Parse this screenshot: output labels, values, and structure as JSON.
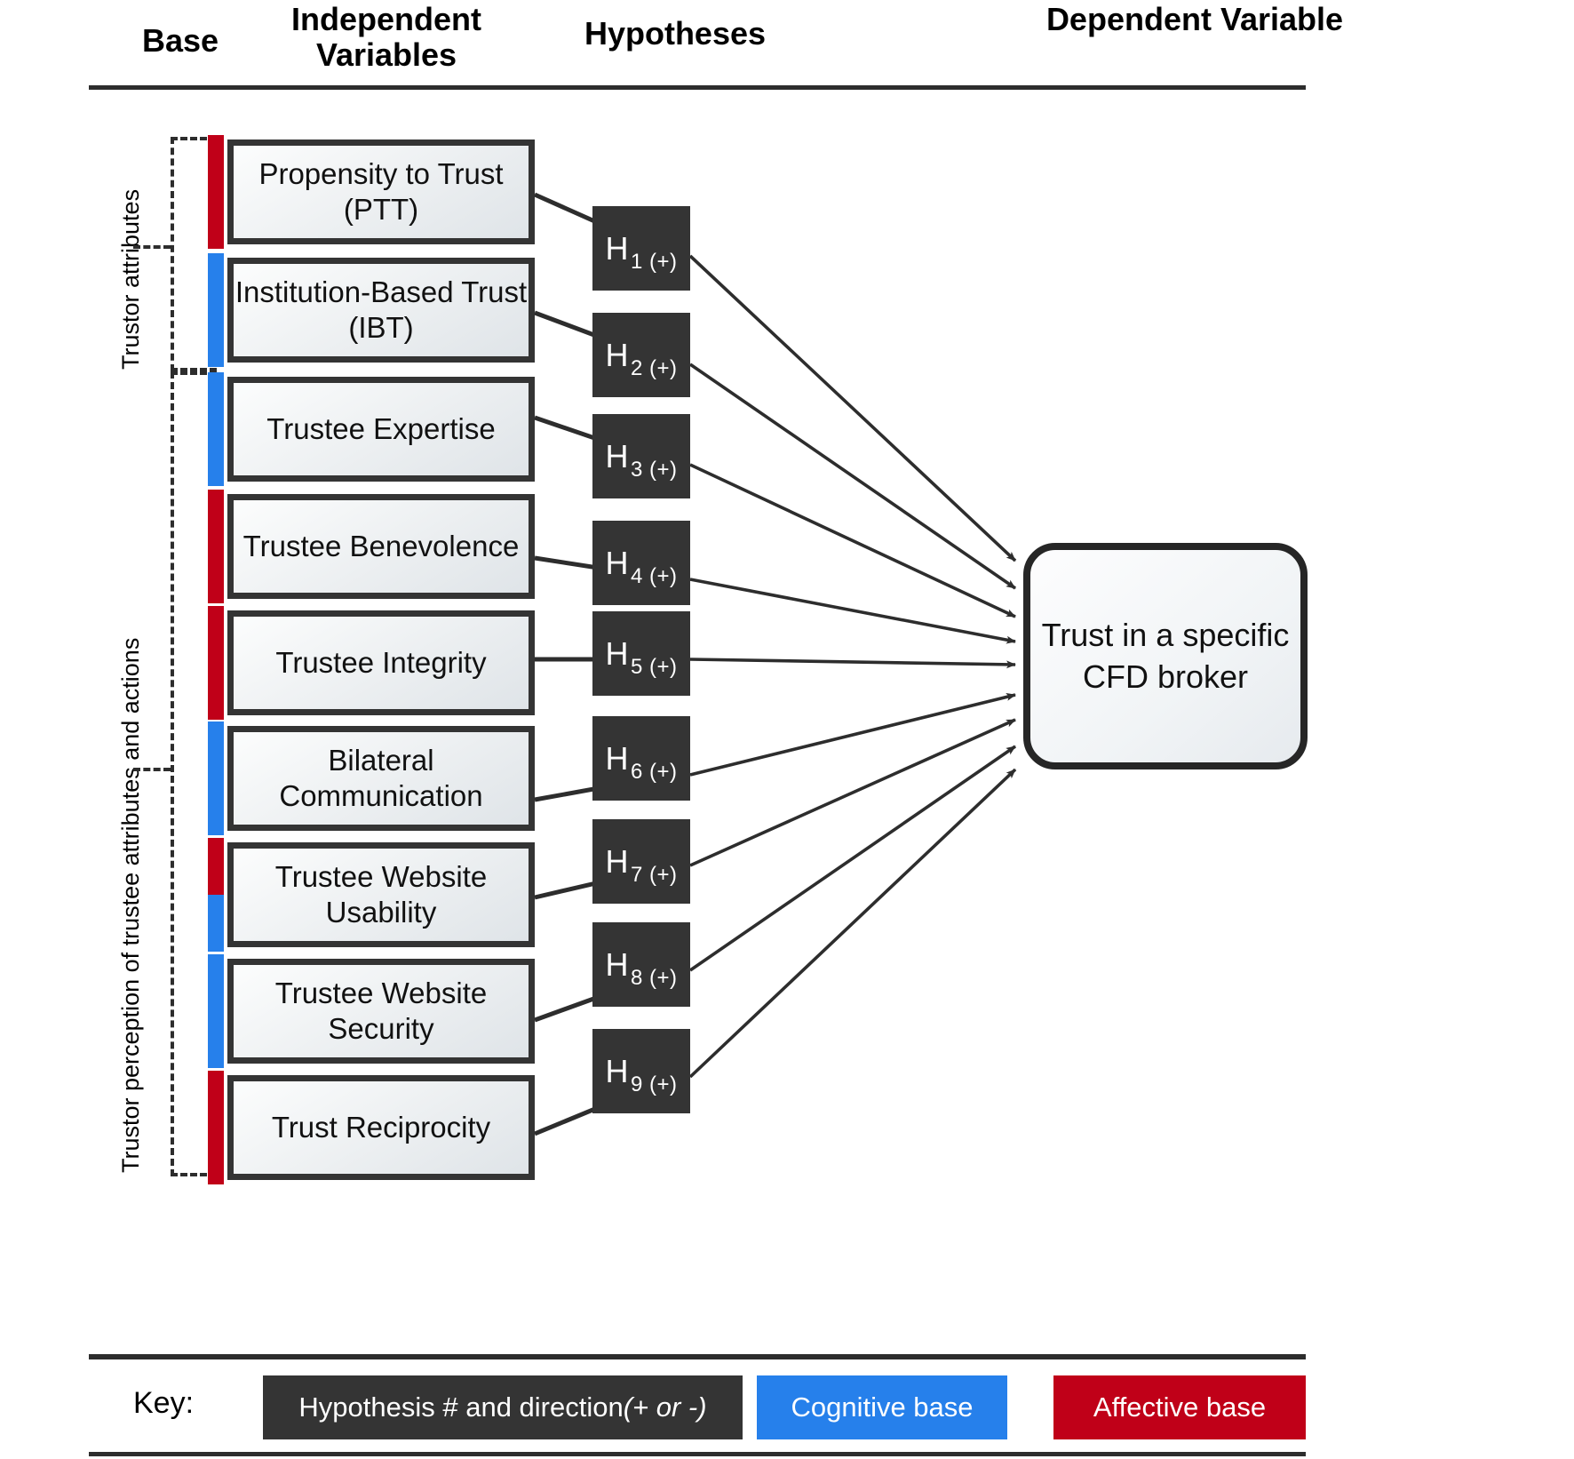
{
  "headers": {
    "base": "Base",
    "independent_variables": "Independent Variables",
    "hypotheses": "Hypotheses",
    "dependent_variable": "Dependent Variable"
  },
  "groups": [
    {
      "id": "trustor-attributes",
      "label": "Trustor attributes"
    },
    {
      "id": "trustor-perception",
      "label": "Trustor perception of trustee attributes and actions"
    }
  ],
  "colors": {
    "cognitive_base": "#2680EB",
    "affective_base": "#C00018",
    "hypothesis_box": "#343434",
    "outline": "#343434"
  },
  "independent_variables": [
    {
      "label": "Propensity to Trust (PTT)",
      "bases": [
        "affective"
      ],
      "hypothesis": "H1"
    },
    {
      "label": "Institution-Based Trust (IBT)",
      "bases": [
        "cognitive"
      ],
      "hypothesis": "H2"
    },
    {
      "label": "Trustee Expertise",
      "bases": [
        "cognitive"
      ],
      "hypothesis": "H3"
    },
    {
      "label": "Trustee Benevolence",
      "bases": [
        "affective"
      ],
      "hypothesis": "H4"
    },
    {
      "label": "Trustee Integrity",
      "bases": [
        "affective"
      ],
      "hypothesis": "H5"
    },
    {
      "label": "Bilateral Communication",
      "bases": [
        "cognitive"
      ],
      "hypothesis": "H6"
    },
    {
      "label": "Trustee Website Usability",
      "bases": [
        "affective",
        "cognitive"
      ],
      "hypothesis": "H7"
    },
    {
      "label": "Trustee Website Security",
      "bases": [
        "cognitive"
      ],
      "hypothesis": "H8"
    },
    {
      "label": "Trust Reciprocity",
      "bases": [
        "affective"
      ],
      "hypothesis": "H9"
    }
  ],
  "hypotheses": [
    {
      "id": "H1",
      "symbol": "H",
      "subscript": "1 (+)",
      "number": 1,
      "direction": "+"
    },
    {
      "id": "H2",
      "symbol": "H",
      "subscript": "2 (+)",
      "number": 2,
      "direction": "+"
    },
    {
      "id": "H3",
      "symbol": "H",
      "subscript": "3 (+)",
      "number": 3,
      "direction": "+"
    },
    {
      "id": "H4",
      "symbol": "H",
      "subscript": "4 (+)",
      "number": 4,
      "direction": "+"
    },
    {
      "id": "H5",
      "symbol": "H",
      "subscript": "5 (+)",
      "number": 5,
      "direction": "+"
    },
    {
      "id": "H6",
      "symbol": "H",
      "subscript": "6 (+)",
      "number": 6,
      "direction": "+"
    },
    {
      "id": "H7",
      "symbol": "H",
      "subscript": "7 (+)",
      "number": 7,
      "direction": "+"
    },
    {
      "id": "H8",
      "symbol": "H",
      "subscript": "8 (+)",
      "number": 8,
      "direction": "+"
    },
    {
      "id": "H9",
      "symbol": "H",
      "subscript": "9 (+)",
      "number": 9,
      "direction": "+"
    }
  ],
  "dependent_variable": {
    "label": "Trust in a specific CFD broker"
  },
  "key": {
    "label": "Key:",
    "hypothesis_chip_prefix": "Hypothesis # and direction ",
    "hypothesis_chip_suffix": "(+ or -)",
    "cognitive_chip": "Cognitive base",
    "affective_chip": "Affective base"
  }
}
